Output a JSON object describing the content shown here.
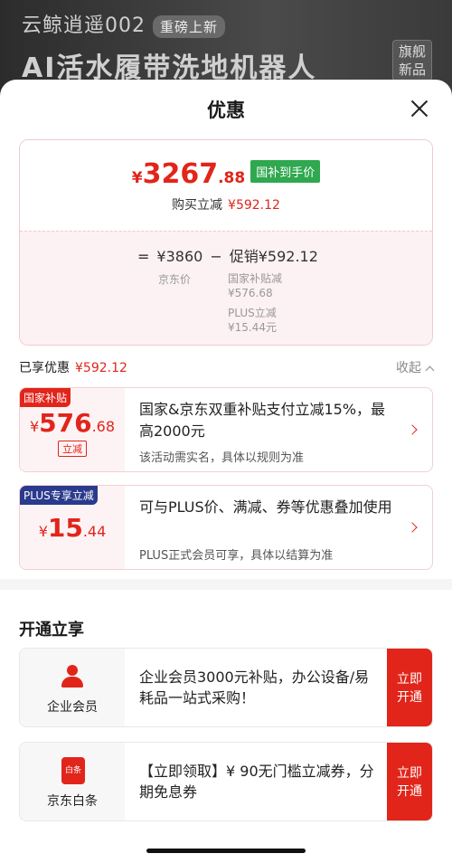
{
  "background": {
    "line1": "云鲸逍遥002",
    "badge": "重磅上新",
    "line2": "AI活水履带洗地机器人",
    "tag_line1": "旗舰",
    "tag_line2": "新品"
  },
  "sheet": {
    "title": "优惠",
    "close_icon": "close-icon"
  },
  "price_card": {
    "yen": "¥",
    "price_int": "3267",
    "price_dec": ".88",
    "badge": "国补到手价",
    "buy_label": "购买立减",
    "buy_amount": "¥592.12",
    "calc_eq": "=",
    "calc_base": "¥3860",
    "calc_minus": "−",
    "calc_promo": "促销¥592.12",
    "jd_label": "京东价",
    "sub1_label": "国家补贴减",
    "sub1_amount": "¥576.68",
    "sub2_label": "PLUS立减",
    "sub2_amount": "¥15.44元"
  },
  "enjoyed": {
    "label": "已享优惠",
    "amount": "¥592.12",
    "collapse": "收起"
  },
  "promos": [
    {
      "tag": "国家补贴",
      "tag_color": "#e1251b",
      "yen": "¥",
      "int": "576",
      "dec": ".68",
      "badge": "立减",
      "text": "国家&京东双重补贴支付立减15%，最高2000元",
      "sub": "该活动需实名，具体以规则为准"
    },
    {
      "tag": "PLUS专享立减",
      "tag_color": "#2a3a8c",
      "yen": "¥",
      "int": "15",
      "dec": ".44",
      "text": "可与PLUS价、满减、券等优惠叠加使用",
      "sub": "PLUS正式会员可享，具体以结算为准"
    }
  ],
  "open_section": {
    "title": "开通立享",
    "items": [
      {
        "icon": "person-icon",
        "name": "企业会员",
        "text": "企业会员3000元补贴，办公设备/易耗品一站式采购！",
        "btn1": "立即",
        "btn2": "开通"
      },
      {
        "icon": "baitiao-icon",
        "icon_text": "白条",
        "name": "京东白条",
        "text": "【立即领取】¥ 90无门槛立减券，分期免息券",
        "btn1": "立即",
        "btn2": "开通"
      }
    ]
  },
  "colors": {
    "accent": "#e1251b",
    "green_badge": "#2fa84f",
    "plus_tag": "#2a3a8c"
  }
}
